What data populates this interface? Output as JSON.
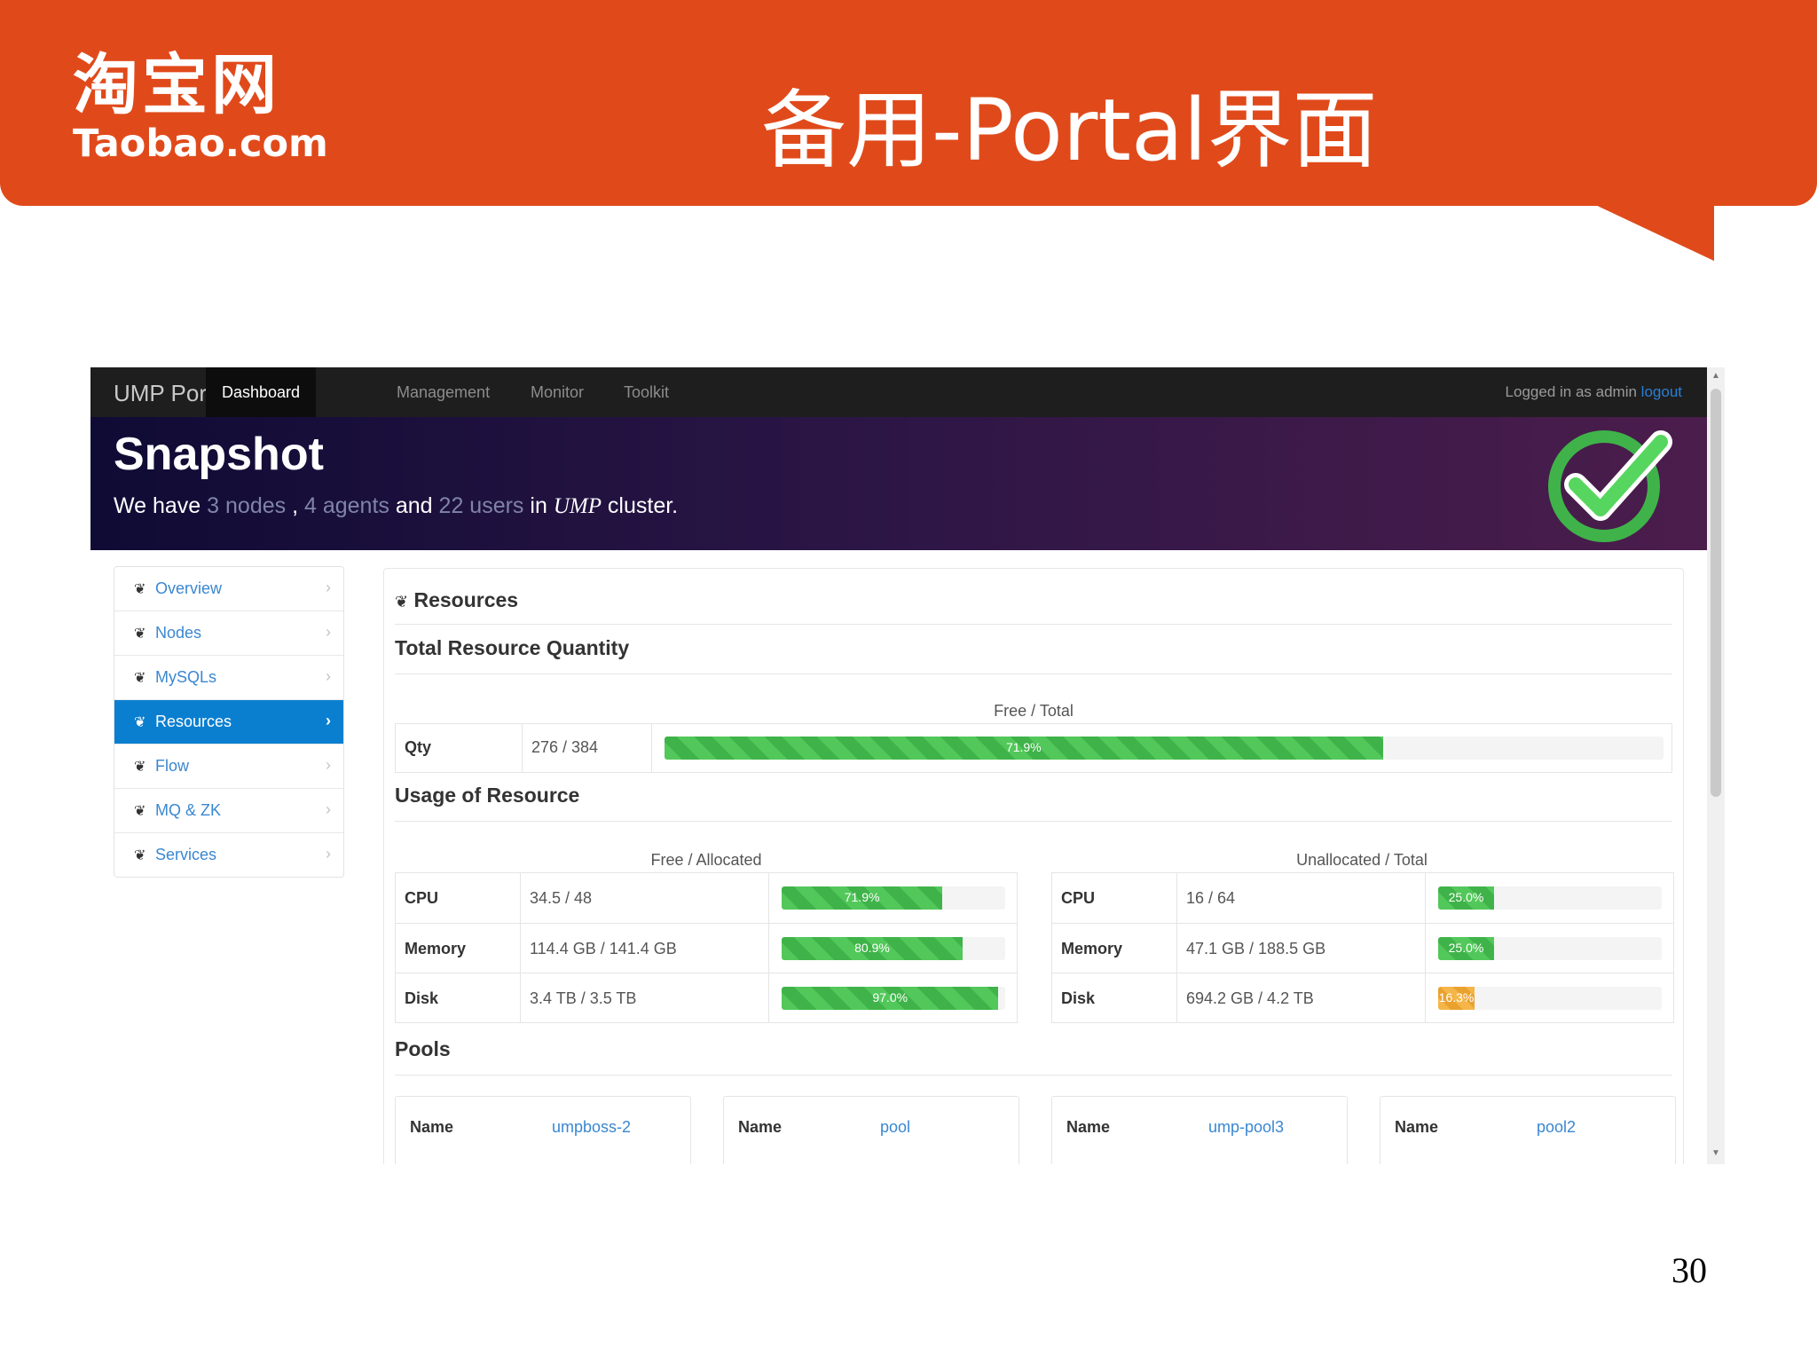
{
  "slide": {
    "logo_cn": "淘宝网",
    "logo_en": "Taobao.com",
    "title": "备用-Portal界面",
    "page_number": "30"
  },
  "navbar": {
    "brand": "UMP Portal",
    "items": [
      "Dashboard",
      "Management",
      "Monitor",
      "Toolkit"
    ],
    "logged_in_text": "Logged in as admin",
    "logout_label": "logout"
  },
  "hero": {
    "title": "Snapshot",
    "we_have": "We have",
    "nodes": "3 nodes",
    "sep": ",",
    "agents": "4 agents",
    "and": "and",
    "users": "22 users",
    "in": "in",
    "cluster_name": "UMP",
    "cluster": "cluster."
  },
  "sidebar": {
    "items": [
      "Overview",
      "Nodes",
      "MySQLs",
      "Resources",
      "Flow",
      "MQ & ZK",
      "Services"
    ],
    "active_index": 3
  },
  "main": {
    "panel_title": "Resources",
    "total_heading": "Total Resource Quantity",
    "total_caption": "Free / Total",
    "qty": {
      "label": "Qty",
      "value": "276 / 384",
      "percent": 71.9,
      "percent_label": "71.9%"
    },
    "usage_heading": "Usage of Resource",
    "allocated_caption": "Free / Allocated",
    "unallocated_caption": "Unallocated / Total",
    "allocated": [
      {
        "label": "CPU",
        "value": "34.5 / 48",
        "percent": 71.9,
        "percent_label": "71.9%"
      },
      {
        "label": "Memory",
        "value": "114.4 GB / 141.4 GB",
        "percent": 80.9,
        "percent_label": "80.9%"
      },
      {
        "label": "Disk",
        "value": "3.4 TB / 3.5 TB",
        "percent": 97.0,
        "percent_label": "97.0%"
      }
    ],
    "unallocated": [
      {
        "label": "CPU",
        "value": "16 / 64",
        "percent": 25.0,
        "percent_label": "25.0%"
      },
      {
        "label": "Memory",
        "value": "47.1 GB / 188.5 GB",
        "percent": 25.0,
        "percent_label": "25.0%"
      },
      {
        "label": "Disk",
        "value": "694.2 GB / 4.2 TB",
        "percent": 16.3,
        "percent_label": "16.3%"
      }
    ],
    "pools_heading": "Pools",
    "pools": [
      {
        "key": "Name",
        "name": "umpboss-2"
      },
      {
        "key": "Name",
        "name": "pool"
      },
      {
        "key": "Name",
        "name": "ump-pool3"
      },
      {
        "key": "Name",
        "name": "pool2"
      }
    ]
  },
  "colors": {
    "slide_orange": "#e04a1b",
    "bar_green": "#52c85a",
    "bar_orange": "#f5b548",
    "link_blue": "#3a87d1",
    "active_blue": "#0a7fd0"
  }
}
